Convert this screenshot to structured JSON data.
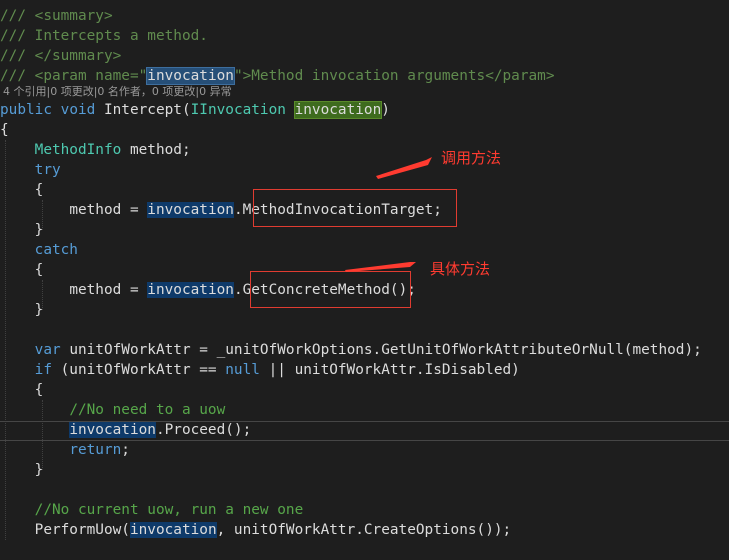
{
  "code": {
    "summary_open": "/// <summary>",
    "summary_text": "/// Intercepts a method.",
    "summary_close": "/// </summary>",
    "param_prefix": "/// <param name=\"",
    "param_name": "invocation",
    "param_suffix": "\">Method invocation arguments</param>",
    "codelens": "4 个引用|0 项更改|0 名作者，0 项更改|0 异常",
    "sig_public": "public",
    "sig_void": "void",
    "sig_method": " Intercept(",
    "sig_type": "IInvocation",
    "sig_param": "invocation",
    "sig_close": ")",
    "brace_open": "{",
    "brace_close": "}",
    "methodinfo_type": "MethodInfo",
    "methodinfo_rest": " method;",
    "kw_try": "try",
    "kw_catch": "catch",
    "assign_prefix": "method = ",
    "var_invocation": "invocation",
    "try_member": "MethodInvocationTarget",
    "try_end": ";",
    "catch_member": "GetConcreteMethod",
    "catch_end": "();",
    "kw_var": "var",
    "var_line_rest": " unitOfWorkAttr = _unitOfWorkOptions.GetUnitOfWorkAttributeOrNull(method);",
    "kw_if": "if",
    "if_a": " (unitOfWorkAttr == ",
    "kw_null": "null",
    "if_b": " || unitOfWorkAttr.IsDisabled)",
    "comment_no_uow": "//No need to a uow",
    "proceed": ".Proceed();",
    "kw_return": "return",
    "return_end": ";",
    "comment_current": "//No current uow, run a new one",
    "perform_prefix": "PerformUow(",
    "perform_suffix": ", unitOfWorkAttr.CreateOptions());"
  },
  "annotations": {
    "call_method": "调用方法",
    "concrete_method": "具体方法"
  },
  "colors": {
    "background": "#1e1e1e",
    "keyword": "#569cd6",
    "type": "#4ec9b0",
    "comment": "#57a64a",
    "annotation_red": "#ff3b30"
  }
}
